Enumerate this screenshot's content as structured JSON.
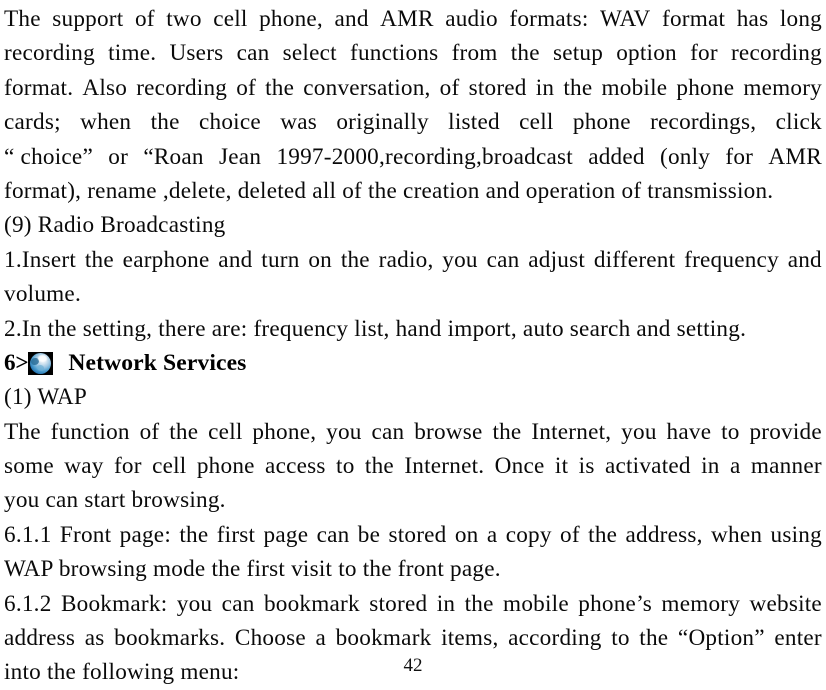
{
  "document": {
    "page_number": "42",
    "lines": [
      {
        "id": "l1",
        "mode": "justified",
        "words": [
          "The",
          "support",
          "of",
          "two",
          "cell",
          "phone,",
          "and",
          "AMR",
          "audio",
          "formats:",
          "WAV",
          "format",
          "has",
          "long"
        ]
      },
      {
        "id": "l2",
        "mode": "justified",
        "words": [
          "recording",
          "time.",
          "Users",
          "can",
          "select",
          "functions",
          "from",
          "the",
          "setup",
          "option",
          "for",
          "recording"
        ]
      },
      {
        "id": "l3",
        "mode": "justified",
        "words": [
          "format.",
          "Also",
          "recording",
          "of",
          "the",
          "conversation,",
          "of",
          "stored",
          "in",
          "the",
          "mobile",
          "phone",
          "memory"
        ]
      },
      {
        "id": "l4",
        "mode": "justified",
        "words": [
          "cards;",
          "when",
          "the",
          "choice",
          "was",
          "originally",
          "listed",
          "cell",
          "phone",
          "recordings,",
          "click"
        ]
      },
      {
        "id": "l5",
        "mode": "justified",
        "words": [
          "“ choice”",
          "or",
          "“Roan",
          "Jean",
          "1997-2000,recording,broadcast",
          "added",
          "(only",
          "for",
          "AMR"
        ]
      },
      {
        "id": "l6",
        "mode": "plain",
        "text": "format), rename ,delete, deleted all of the creation and operation of transmission."
      },
      {
        "id": "l7",
        "mode": "plain",
        "text": "(9)    Radio Broadcasting"
      },
      {
        "id": "l8",
        "mode": "justified",
        "words": [
          "1.Insert",
          "the",
          "earphone",
          "and",
          "turn",
          "on",
          "the",
          "radio,",
          "you",
          "can",
          "adjust",
          "different",
          "frequency",
          "and"
        ]
      },
      {
        "id": "l9",
        "mode": "plain",
        "text": "volume."
      },
      {
        "id": "l10",
        "mode": "plain",
        "text": "2.In the setting, there are: frequency list, hand import, auto search and setting."
      },
      {
        "id": "l12",
        "mode": "plain",
        "text": "(1) WAP"
      },
      {
        "id": "l13",
        "mode": "justified",
        "words": [
          "The",
          "function",
          "of",
          "the",
          "cell",
          "phone,",
          "you",
          "can",
          "browse",
          "the",
          "Internet,",
          "you",
          "have",
          "to",
          "provide"
        ]
      },
      {
        "id": "l14",
        "mode": "justified",
        "words": [
          "some",
          "way",
          "for",
          "cell",
          "phone",
          "access",
          "to",
          "the",
          "Internet.",
          "Once",
          "it",
          "is",
          "activated",
          "in",
          "a",
          "manner"
        ]
      },
      {
        "id": "l15",
        "mode": "plain",
        "text": "you can start browsing."
      },
      {
        "id": "l16",
        "mode": "justified",
        "words": [
          "6.1.1",
          "Front",
          "page:",
          "the",
          "first",
          "page",
          "can",
          "be",
          "stored",
          "on",
          "a",
          "copy",
          "of",
          "the",
          "address,",
          "when",
          "using"
        ]
      },
      {
        "id": "l17",
        "mode": "plain",
        "text": "WAP browsing mode the first visit to the front page."
      },
      {
        "id": "l18",
        "mode": "justified",
        "words": [
          "6.1.2",
          "Bookmark:",
          "you",
          "can",
          "bookmark",
          "stored",
          "in",
          "the",
          "mobile",
          "phone’s",
          "memory",
          "website"
        ]
      },
      {
        "id": "l19",
        "mode": "justified",
        "words": [
          "address",
          "as",
          "bookmarks.",
          "Choose",
          "a",
          "bookmark",
          "items,",
          "according",
          "to",
          "the",
          "“Option”",
          "enter"
        ]
      },
      {
        "id": "l20",
        "mode": "plain",
        "text": "into the following menu:"
      }
    ],
    "heading": {
      "prefix": "6>",
      "icon_name": "globe-icon",
      "title": "Network Services"
    }
  }
}
